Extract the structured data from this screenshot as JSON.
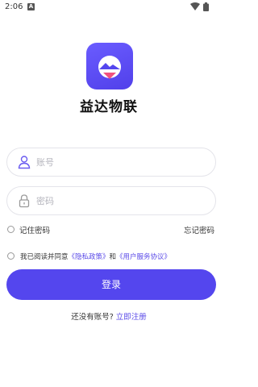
{
  "status_bar": {
    "time": "2:06",
    "notification_badge": "A"
  },
  "app": {
    "name": "益达物联",
    "brand_color": "#5446ee"
  },
  "login_form": {
    "account_placeholder": "账号",
    "password_placeholder": "密码",
    "remember_label": "记住密码",
    "forgot_label": "忘记密码",
    "agreement": {
      "prefix": "我已阅读并同意",
      "privacy_link": "《隐私政策》",
      "conjunction": "和",
      "service_link": "《用户服务协议》"
    },
    "login_button": "登录"
  },
  "register": {
    "prompt": "还没有账号?",
    "link": "立即注册"
  },
  "icons": {
    "account": "user-icon",
    "password": "lock-icon",
    "logo": "app-logo-icon",
    "wifi": "wifi-icon",
    "battery": "battery-icon"
  }
}
